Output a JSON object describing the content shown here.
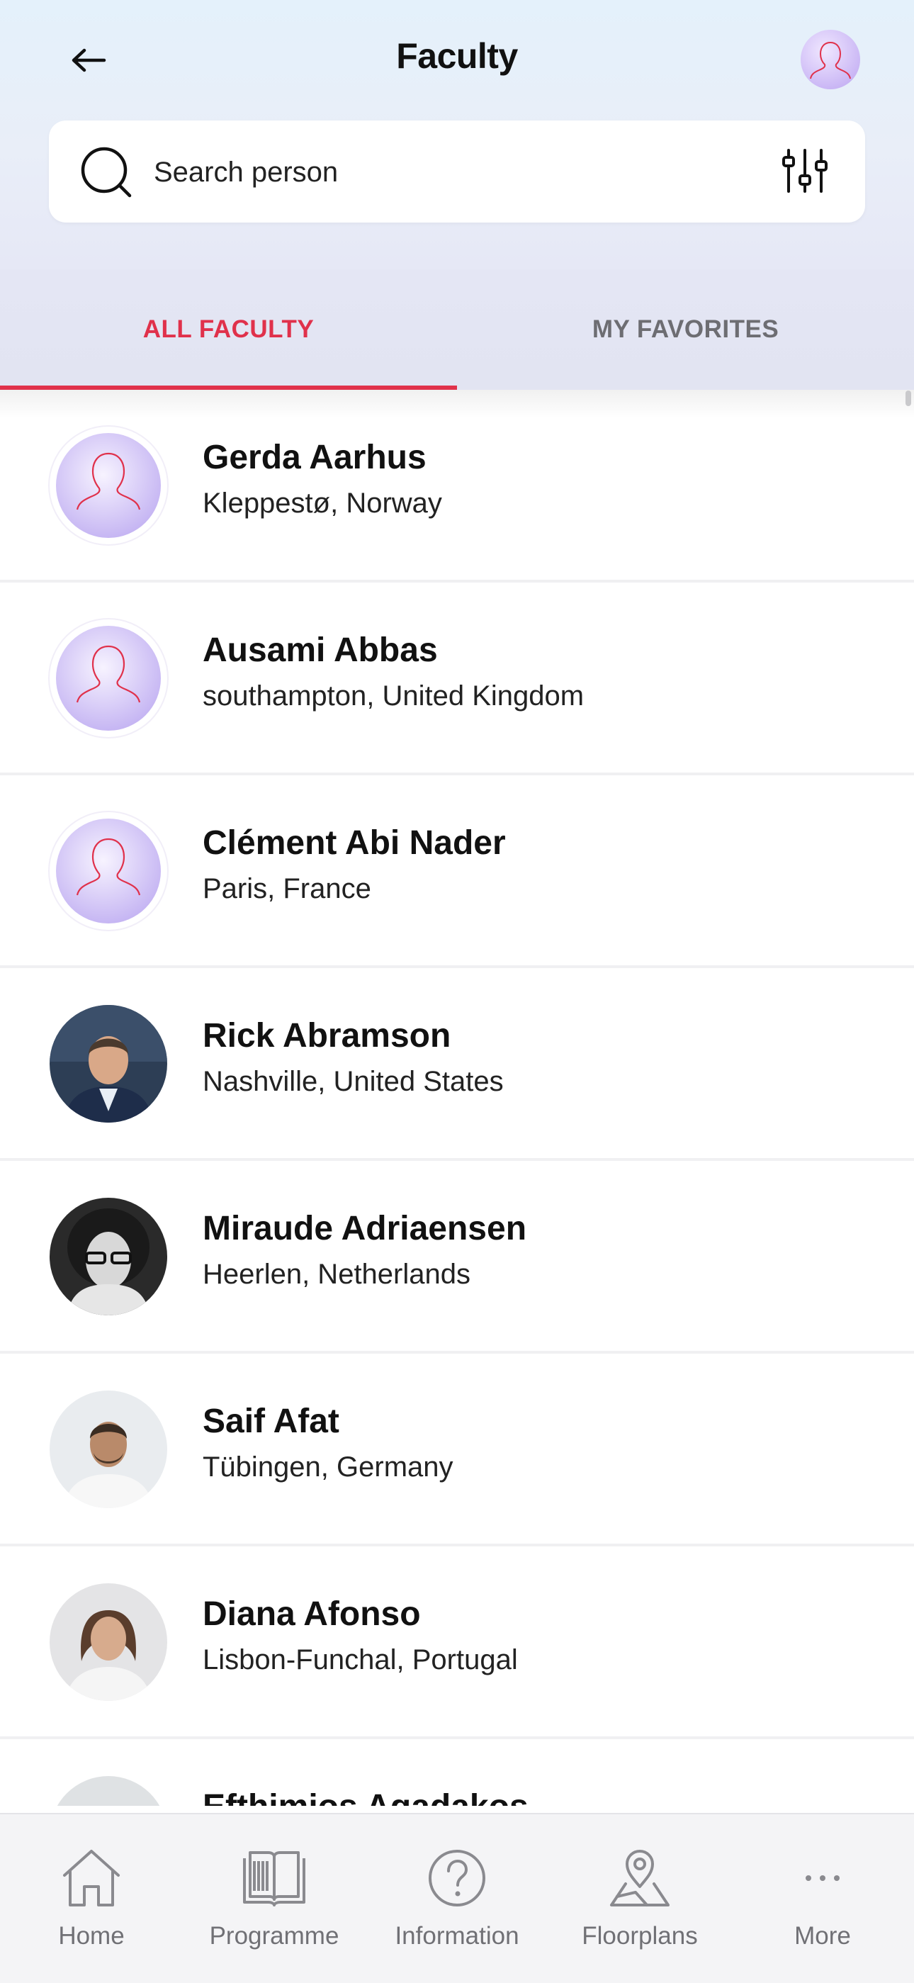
{
  "header": {
    "title": "Faculty"
  },
  "search": {
    "placeholder": "Search person"
  },
  "tabs": [
    {
      "label": "ALL FACULTY",
      "active": true
    },
    {
      "label": "MY FAVORITES",
      "active": false
    }
  ],
  "colors": {
    "accent": "#e0314b",
    "tab_inactive": "#6d6d72",
    "avatar_placeholder": "#cbb8f5"
  },
  "faculty": [
    {
      "name": "Gerda Aarhus",
      "location": "Kleppestø, Norway",
      "avatar": "placeholder"
    },
    {
      "name": "Ausami Abbas",
      "location": "southampton, United Kingdom",
      "avatar": "placeholder"
    },
    {
      "name": "Clément Abi Nader",
      "location": "Paris, France",
      "avatar": "placeholder"
    },
    {
      "name": "Rick Abramson",
      "location": "Nashville, United States",
      "avatar": "photo"
    },
    {
      "name": "Miraude Adriaensen",
      "location": "Heerlen, Netherlands",
      "avatar": "photo"
    },
    {
      "name": "Saif Afat",
      "location": "Tübingen, Germany",
      "avatar": "photo"
    },
    {
      "name": "Diana Afonso",
      "location": "Lisbon-Funchal, Portugal",
      "avatar": "photo"
    },
    {
      "name": "Efthimios Agadakos",
      "location": "",
      "avatar": "photo"
    }
  ],
  "nav": [
    {
      "label": "Home",
      "icon": "home-icon"
    },
    {
      "label": "Programme",
      "icon": "book-icon"
    },
    {
      "label": "Information",
      "icon": "question-icon"
    },
    {
      "label": "Floorplans",
      "icon": "map-pin-icon"
    },
    {
      "label": "More",
      "icon": "more-dots-icon"
    }
  ]
}
